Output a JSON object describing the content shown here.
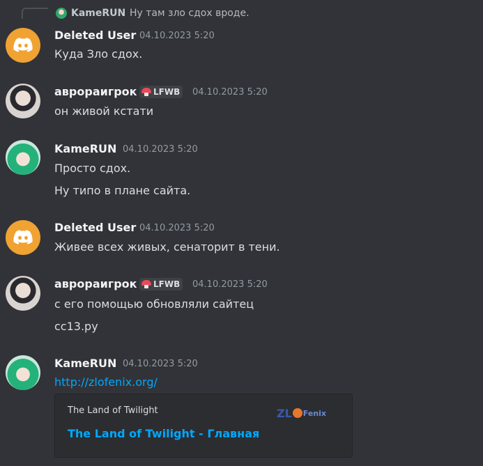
{
  "reply": {
    "author": "KameRUN",
    "text": "Ну там зло сдох вроде."
  },
  "messages": [
    {
      "author": "Deleted User",
      "timestamp": "04.10.2023 5:20",
      "lines": [
        "Куда Зло сдох."
      ]
    },
    {
      "author": "аврораигрок",
      "tag": "LFWB",
      "timestamp": "04.10.2023 5:20",
      "lines": [
        "он живой кстати"
      ]
    },
    {
      "author": "KameRUN",
      "timestamp": "04.10.2023 5:20",
      "lines": [
        "Просто сдох.",
        "Ну типо в плане сайта."
      ]
    },
    {
      "author": "Deleted User",
      "timestamp": "04.10.2023 5:20",
      "lines": [
        "Живее всех живых, сенаторит в тени."
      ]
    },
    {
      "author": "аврораигрок",
      "tag": "LFWB",
      "timestamp": "04.10.2023 5:20",
      "lines": [
        "с его помощью обновляли сайтец",
        "cc13.ру"
      ]
    },
    {
      "author": "KameRUN",
      "timestamp": "04.10.2023 5:20",
      "link": "http://zlofenix.org/"
    }
  ],
  "embed": {
    "provider": "The Land of Twilight",
    "title": "The Land of Twilight - Главная",
    "logo_text": {
      "part1": "ZL",
      "part2": "Fenix"
    }
  },
  "icons": {
    "deleted_user_avatar": "discord-logo-icon",
    "tag_icon": "mushroom-icon"
  },
  "colors": {
    "background": "#313338",
    "link": "#00a8fc",
    "discord_avatar": "#f0a232"
  }
}
